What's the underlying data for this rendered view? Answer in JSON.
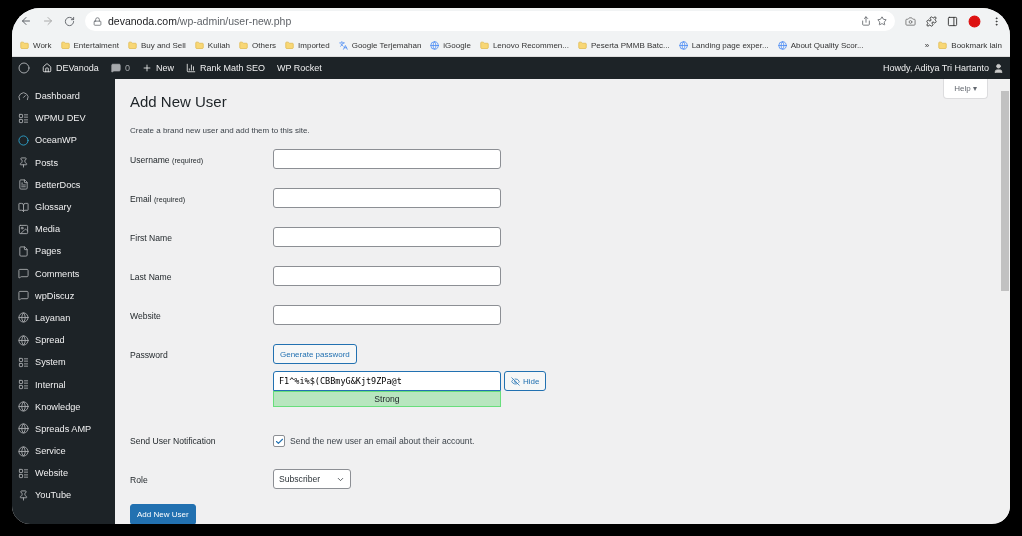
{
  "browser": {
    "url_host": "devanoda.com",
    "url_path": "/wp-admin/user-new.php",
    "bookmarks": [
      "Work",
      "Entertaiment",
      "Buy and Sell",
      "Kuliah",
      "Others",
      "Imported",
      "Google Terjemahan",
      "iGoogle",
      "Lenovo Recommen...",
      "Peserta PMMB Batc...",
      "Landing page exper...",
      "About Quality Scor..."
    ],
    "overflow": "»",
    "other_bookmarks": "Bookmark lain"
  },
  "admin_bar": {
    "site": "DEVanoda",
    "comments": "0",
    "new": "New",
    "items": [
      "Rank Math SEO",
      "WP Rocket"
    ],
    "greeting": "Howdy, Aditya Tri Hartanto"
  },
  "sidebar": {
    "items": [
      {
        "label": "Dashboard"
      },
      {
        "label": "WPMU DEV"
      },
      {
        "label": "OceanWP"
      },
      {
        "label": "Posts"
      },
      {
        "label": "BetterDocs"
      },
      {
        "label": "Glossary"
      },
      {
        "label": "Media"
      },
      {
        "label": "Pages"
      },
      {
        "label": "Comments"
      },
      {
        "label": "wpDiscuz"
      },
      {
        "label": "Layanan"
      },
      {
        "label": "Spread"
      },
      {
        "label": "System"
      },
      {
        "label": "Internal"
      },
      {
        "label": "Knowledge"
      },
      {
        "label": "Spreads AMP"
      },
      {
        "label": "Service"
      },
      {
        "label": "Website"
      },
      {
        "label": "YouTube"
      }
    ]
  },
  "page": {
    "title": "Add New User",
    "help": "Help",
    "help_caret": "▾",
    "description": "Create a brand new user and add them to this site.",
    "fields": [
      {
        "kind": "text",
        "label": "Username",
        "note": "(required)"
      },
      {
        "kind": "text",
        "label": "Email",
        "note": "(required)"
      },
      {
        "kind": "text",
        "label": "First Name"
      },
      {
        "kind": "text",
        "label": "Last Name"
      },
      {
        "kind": "text",
        "label": "Website"
      },
      {
        "kind": "password",
        "label": "Password",
        "generate": "Generate password",
        "value": "F1^%i%$(CBBmyG&Kjt9ZPa@t",
        "strength": "Strong",
        "toggle": "Hide"
      },
      {
        "kind": "checkbox",
        "label": "Send User Notification",
        "checked": true,
        "text": "Send the new user an email about their account."
      },
      {
        "kind": "select",
        "label": "Role",
        "value": "Subscriber"
      }
    ],
    "submit": "Add New User"
  }
}
